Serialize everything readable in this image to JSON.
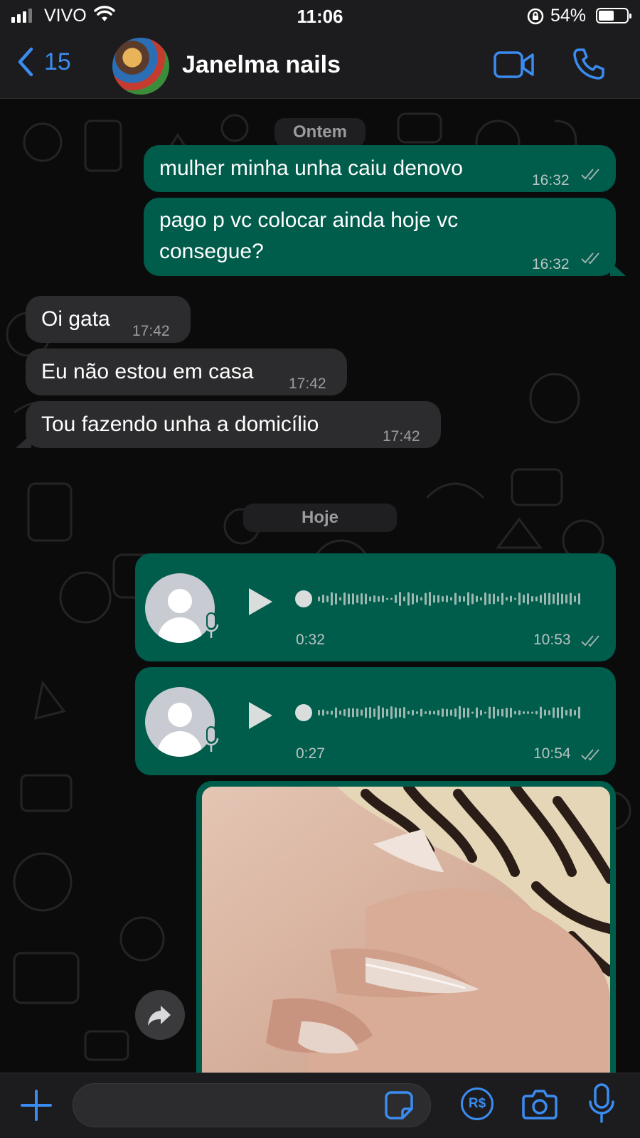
{
  "status_bar": {
    "carrier": "VIVO",
    "time": "11:06",
    "battery_text": "54%",
    "battery_level": 0.54
  },
  "header": {
    "back_count": "15",
    "contact_name": "Janelma nails",
    "icons": [
      "chevron-left-icon",
      "video-camera-icon",
      "phone-icon"
    ]
  },
  "chat": {
    "divider_yesterday": "Ontem",
    "divider_today": "Hoje",
    "messages": [
      {
        "direction": "out",
        "text": "mulher minha unha caiu denovo",
        "time": "16:32"
      },
      {
        "direction": "out",
        "text_line1": "pago p vc colocar ainda hoje vc",
        "text_line2": "consegue?",
        "time": "16:32"
      },
      {
        "direction": "in",
        "text": "Oi gata",
        "time": "17:42"
      },
      {
        "direction": "in",
        "text": "Eu não estou em casa",
        "time": "17:42"
      },
      {
        "direction": "in",
        "text": "Tou fazendo unha a domicílio",
        "time": "17:42"
      }
    ],
    "voice_notes": [
      {
        "duration": "0:32",
        "time": "10:53",
        "progress": 0
      },
      {
        "duration": "0:27",
        "time": "10:54",
        "progress": 0
      }
    ],
    "image_message": {
      "description_icon": "photo-nails"
    }
  },
  "composer": {
    "placeholder": "",
    "icons": [
      "plus-icon",
      "sticker-icon",
      "payment-icon",
      "camera-icon",
      "microphone-icon"
    ],
    "pay_label": "R$"
  },
  "colors": {
    "accent": "#3b8cf0",
    "outgoing_bubble": "#005c4b",
    "incoming_bubble": "#2c2c2e",
    "header_bg": "#1c1c1e"
  }
}
